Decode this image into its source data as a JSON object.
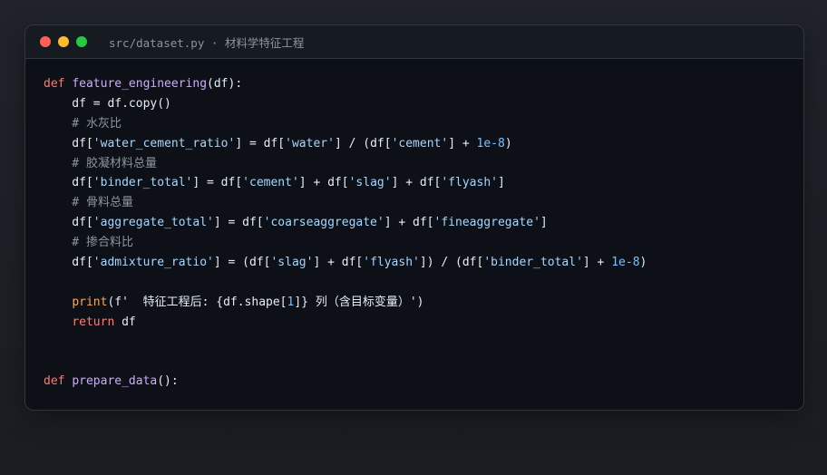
{
  "window": {
    "title": "src/dataset.py · 材料学特征工程",
    "controls": [
      "close",
      "minimize",
      "maximize"
    ]
  },
  "code_lines": [
    [
      {
        "t": "kw",
        "v": "def "
      },
      {
        "t": "fn",
        "v": "feature_engineering"
      },
      {
        "t": "txt",
        "v": "(df):"
      }
    ],
    [
      {
        "t": "txt",
        "v": "    df = df.copy()"
      }
    ],
    [
      {
        "t": "cmt",
        "v": "    # 水灰比"
      }
    ],
    [
      {
        "t": "txt",
        "v": "    df["
      },
      {
        "t": "str",
        "v": "'water_cement_ratio'"
      },
      {
        "t": "txt",
        "v": "] = df["
      },
      {
        "t": "str",
        "v": "'water'"
      },
      {
        "t": "txt",
        "v": "] / (df["
      },
      {
        "t": "str",
        "v": "'cement'"
      },
      {
        "t": "txt",
        "v": "] + "
      },
      {
        "t": "num",
        "v": "1e-8"
      },
      {
        "t": "txt",
        "v": ")"
      }
    ],
    [
      {
        "t": "cmt",
        "v": "    # 胶凝材料总量"
      }
    ],
    [
      {
        "t": "txt",
        "v": "    df["
      },
      {
        "t": "str",
        "v": "'binder_total'"
      },
      {
        "t": "txt",
        "v": "] = df["
      },
      {
        "t": "str",
        "v": "'cement'"
      },
      {
        "t": "txt",
        "v": "] + df["
      },
      {
        "t": "str",
        "v": "'slag'"
      },
      {
        "t": "txt",
        "v": "] + df["
      },
      {
        "t": "str",
        "v": "'flyash'"
      },
      {
        "t": "txt",
        "v": "]"
      }
    ],
    [
      {
        "t": "cmt",
        "v": "    # 骨料总量"
      }
    ],
    [
      {
        "t": "txt",
        "v": "    df["
      },
      {
        "t": "str",
        "v": "'aggregate_total'"
      },
      {
        "t": "txt",
        "v": "] = df["
      },
      {
        "t": "str",
        "v": "'coarseaggregate'"
      },
      {
        "t": "txt",
        "v": "] + df["
      },
      {
        "t": "str",
        "v": "'fineaggregate'"
      },
      {
        "t": "txt",
        "v": "]"
      }
    ],
    [
      {
        "t": "cmt",
        "v": "    # 掺合料比"
      }
    ],
    [
      {
        "t": "txt",
        "v": "    df["
      },
      {
        "t": "str",
        "v": "'admixture_ratio'"
      },
      {
        "t": "txt",
        "v": "] = (df["
      },
      {
        "t": "str",
        "v": "'slag'"
      },
      {
        "t": "txt",
        "v": "] + df["
      },
      {
        "t": "str",
        "v": "'flyash'"
      },
      {
        "t": "txt",
        "v": "]) / (df["
      },
      {
        "t": "str",
        "v": "'binder_total'"
      },
      {
        "t": "txt",
        "v": "] + "
      },
      {
        "t": "num",
        "v": "1e-8"
      },
      {
        "t": "txt",
        "v": ")"
      }
    ],
    [],
    [
      {
        "t": "txt",
        "v": "    "
      },
      {
        "t": "bi",
        "v": "print"
      },
      {
        "t": "txt",
        "v": "(f'  特征工程后: {df.shape["
      },
      {
        "t": "num",
        "v": "1"
      },
      {
        "t": "txt",
        "v": "]} 列（含目标变量）')"
      }
    ],
    [
      {
        "t": "txt",
        "v": "    "
      },
      {
        "t": "kw",
        "v": "return"
      },
      {
        "t": "txt",
        "v": " df"
      }
    ],
    [],
    [],
    [
      {
        "t": "kw",
        "v": "def "
      },
      {
        "t": "fn",
        "v": "prepare_data"
      },
      {
        "t": "txt",
        "v": "():"
      }
    ]
  ],
  "theme": {
    "background": "#0d1117",
    "titlebar": "#161b22",
    "keyword": "#ff7b72",
    "function": "#d2a8ff",
    "string": "#a5d6ff",
    "number": "#79c0ff",
    "comment": "#8b949e",
    "builtin": "#ffa657",
    "text": "#e6edf3"
  }
}
